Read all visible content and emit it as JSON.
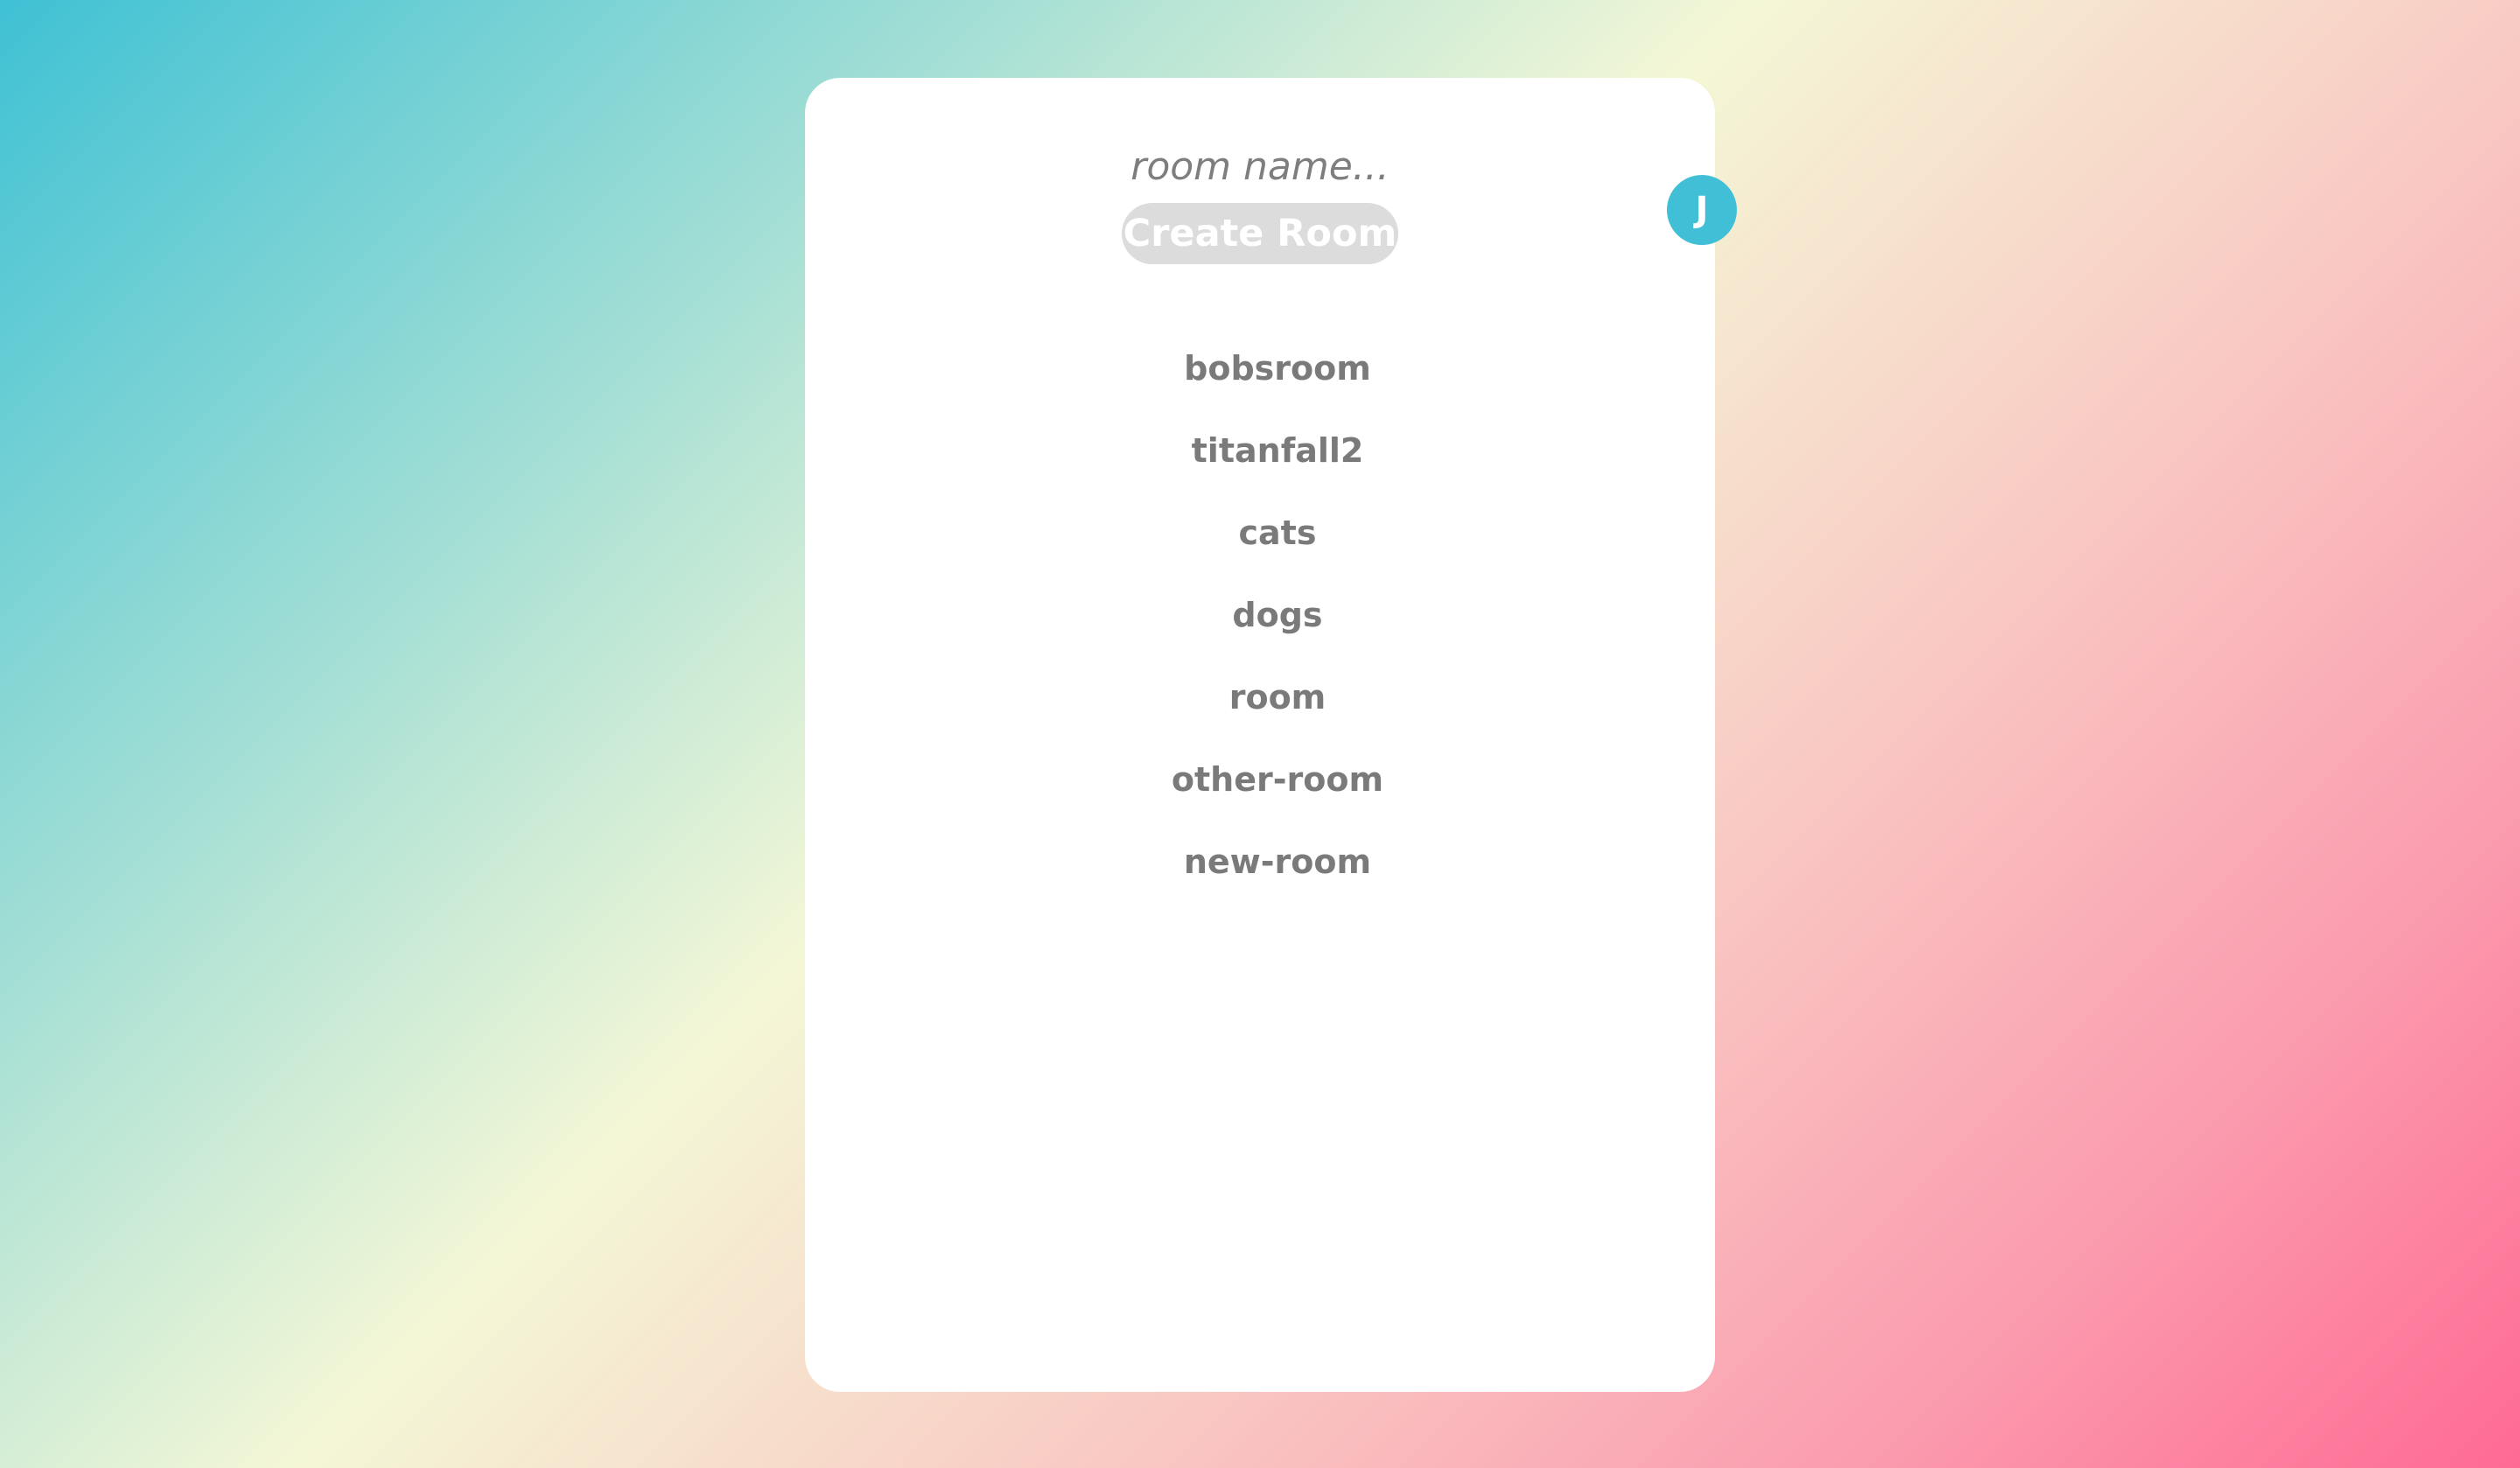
{
  "search": {
    "placeholder": "room name..."
  },
  "create_button": {
    "label": "Create Room"
  },
  "user": {
    "initial": "J",
    "avatar_color": "#40bfd6"
  },
  "rooms": [
    {
      "name": "bobsroom"
    },
    {
      "name": "titanfall2"
    },
    {
      "name": "cats"
    },
    {
      "name": "dogs"
    },
    {
      "name": "room"
    },
    {
      "name": "other-room"
    },
    {
      "name": "new-room"
    }
  ],
  "colors": {
    "gradient": [
      "#3fc1d4",
      "#a8e0d5",
      "#f4f7d6",
      "#f9c6c2",
      "#fb9aae",
      "#ff6a93"
    ],
    "panel": "#ffffff",
    "button_bg": "#dcdcdc",
    "text_gray": "#7a7a7a"
  }
}
